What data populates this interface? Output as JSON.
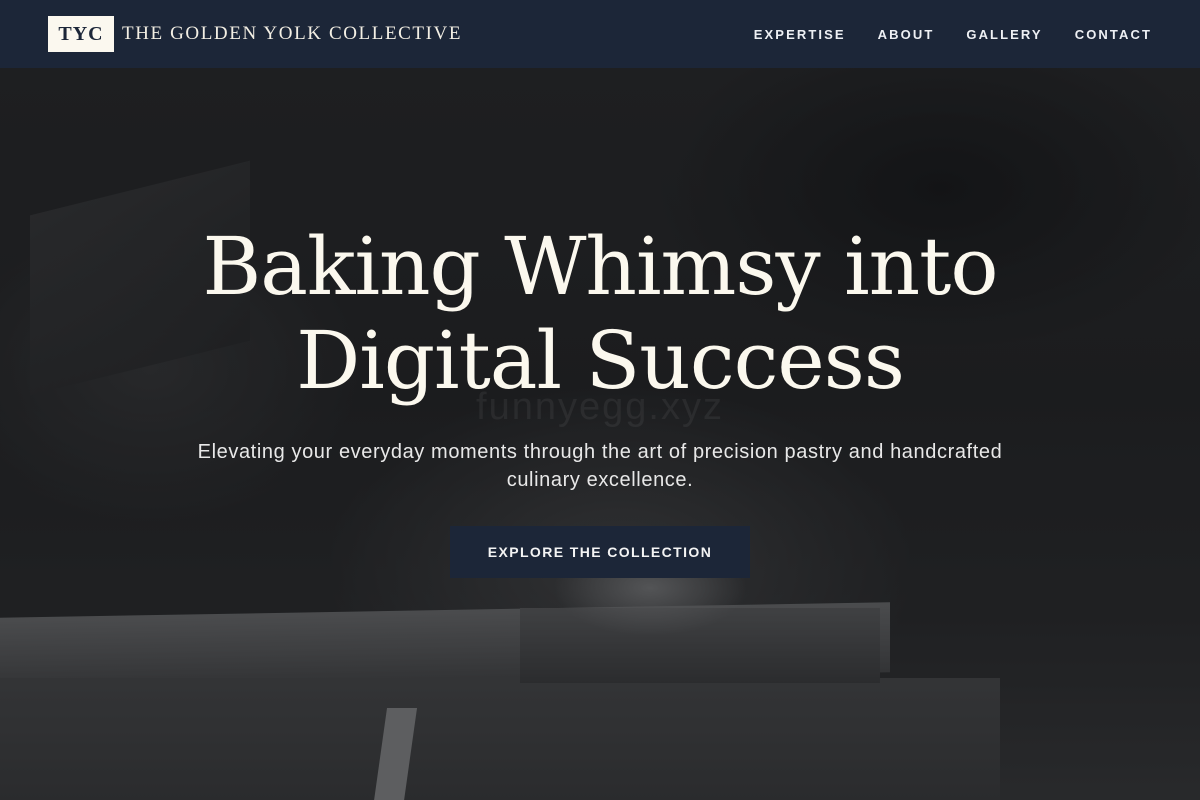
{
  "brand": {
    "badge": "TYC",
    "name": "THE GOLDEN YOLK COLLECTIVE"
  },
  "nav": {
    "items": [
      {
        "label": "EXPERTISE"
      },
      {
        "label": "ABOUT"
      },
      {
        "label": "GALLERY"
      },
      {
        "label": "CONTACT"
      }
    ]
  },
  "hero": {
    "title_line1": "Baking Whimsy into",
    "title_line2": "Digital Success",
    "watermark": "funnyegg.xyz",
    "subtitle": "Elevating your everyday moments through the art of precision pastry and handcrafted culinary excellence.",
    "cta_label": "EXPLORE THE COLLECTION"
  },
  "colors": {
    "navbar_bg": "#1c2638",
    "cream": "#fbf8ef",
    "cta_bg": "#1c2638"
  }
}
